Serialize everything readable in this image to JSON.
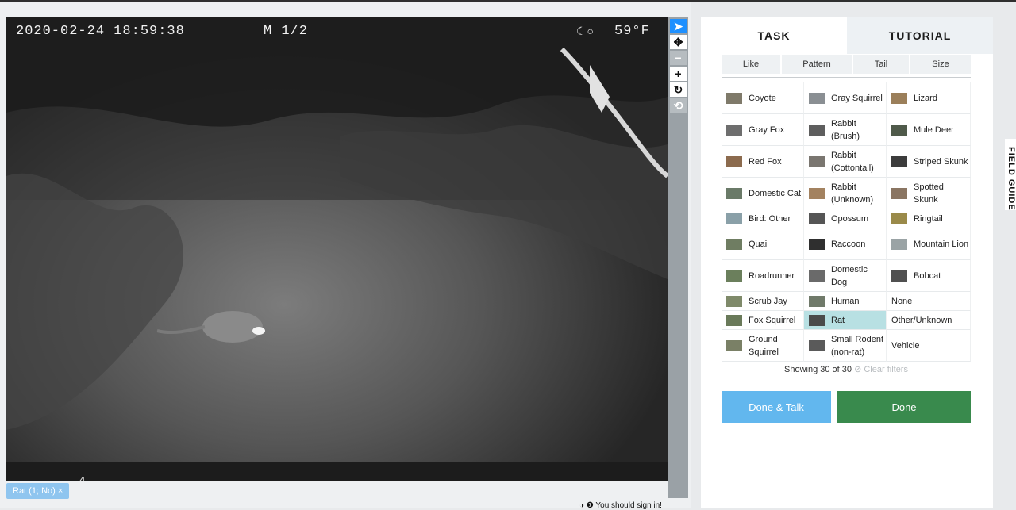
{
  "camera": {
    "datetime": "2020-02-24  18:59:38",
    "mode": "M 1/2",
    "moon": "☾○",
    "temperature": "59°F",
    "footer_text": "4"
  },
  "tools": [
    {
      "icon": "pointer-icon",
      "glyph": "➤"
    },
    {
      "icon": "move-icon",
      "glyph": "✥"
    },
    {
      "icon": "zoom-out-icon",
      "glyph": "−"
    },
    {
      "icon": "zoom-in-icon",
      "glyph": "+"
    },
    {
      "icon": "rotate-icon",
      "glyph": "↻"
    },
    {
      "icon": "reset-icon",
      "glyph": "⟲"
    }
  ],
  "subject_tag": "Rat (1; No) ×",
  "tabs": {
    "task": "TASK",
    "tutorial": "TUTORIAL"
  },
  "filters": [
    "Like",
    "Pattern",
    "Tail",
    "Size"
  ],
  "species": [
    {
      "name": "Coyote",
      "color": "#7f7a6a"
    },
    {
      "name": "Gray Squirrel",
      "color": "#8a8f93"
    },
    {
      "name": "Lizard",
      "color": "#9b7f5a"
    },
    {
      "name": "Gray Fox",
      "color": "#6e6e6e"
    },
    {
      "name": "Rabbit (Brush)",
      "color": "#5e5e5e"
    },
    {
      "name": "Mule Deer",
      "color": "#4f5a4a"
    },
    {
      "name": "Red Fox",
      "color": "#8c6b4e"
    },
    {
      "name": "Rabbit (Cottontail)",
      "color": "#7a7670"
    },
    {
      "name": "Striped Skunk",
      "color": "#3c3c3c"
    },
    {
      "name": "Domestic Cat",
      "color": "#6a7a68"
    },
    {
      "name": "Rabbit (Unknown)",
      "color": "#a38260"
    },
    {
      "name": "Spotted Skunk",
      "color": "#8a7562"
    },
    {
      "name": "Bird: Other",
      "color": "#8aa0a8"
    },
    {
      "name": "Opossum",
      "color": "#555555"
    },
    {
      "name": "Ringtail",
      "color": "#9a8a4a"
    },
    {
      "name": "Quail",
      "color": "#6f7d62"
    },
    {
      "name": "Raccoon",
      "color": "#2f2f2f"
    },
    {
      "name": "Mountain Lion",
      "color": "#9aa3a5"
    },
    {
      "name": "Roadrunner",
      "color": "#6b7f5c"
    },
    {
      "name": "Domestic Dog",
      "color": "#6a6a6a"
    },
    {
      "name": "Bobcat",
      "color": "#505050"
    },
    {
      "name": "Scrub Jay",
      "color": "#7f8a6a"
    },
    {
      "name": "Human",
      "color": "#707a6a"
    },
    {
      "name": "None",
      "color": ""
    },
    {
      "name": "Fox Squirrel",
      "color": "#6a7a5a"
    },
    {
      "name": "Rat",
      "color": "#4a4a4a",
      "selected": true
    },
    {
      "name": "Other/Unknown",
      "color": ""
    },
    {
      "name": "Ground Squirrel",
      "color": "#7a8066"
    },
    {
      "name": "Small Rodent (non-rat)",
      "color": "#5a5a5a"
    },
    {
      "name": "Vehicle",
      "color": ""
    }
  ],
  "showing": "Showing 30 of 30",
  "clear_filters": "⊘ Clear filters",
  "buttons": {
    "done_talk": "Done & Talk",
    "done": "Done"
  },
  "field_guide": "FIELD GUIDE",
  "signin_notice": "◑ ❶ You should sign in!"
}
